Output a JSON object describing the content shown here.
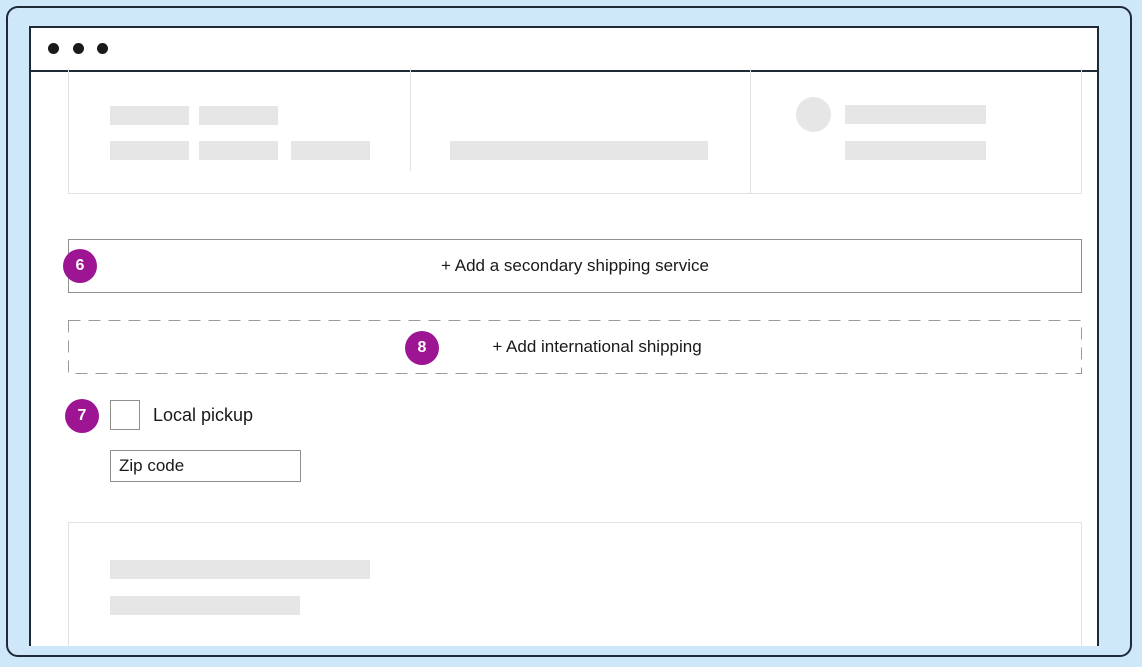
{
  "window": {
    "titlebar_dots": 3
  },
  "shipping": {
    "secondary_service_button": "+ Add a secondary shipping service",
    "international_button": "+ Add international shipping",
    "local_pickup_label": "Local pickup",
    "local_pickup_checked": false,
    "zip_placeholder": "Zip code"
  },
  "callouts": {
    "secondary": "6",
    "local_pickup": "7",
    "international": "8"
  },
  "colors": {
    "background": "#cfe8f9",
    "badge": "#9d1593",
    "skeleton": "#e6e6e6",
    "border": "#1e2a36"
  },
  "icons": [
    "window-dot-icon",
    "avatar-placeholder-icon"
  ]
}
